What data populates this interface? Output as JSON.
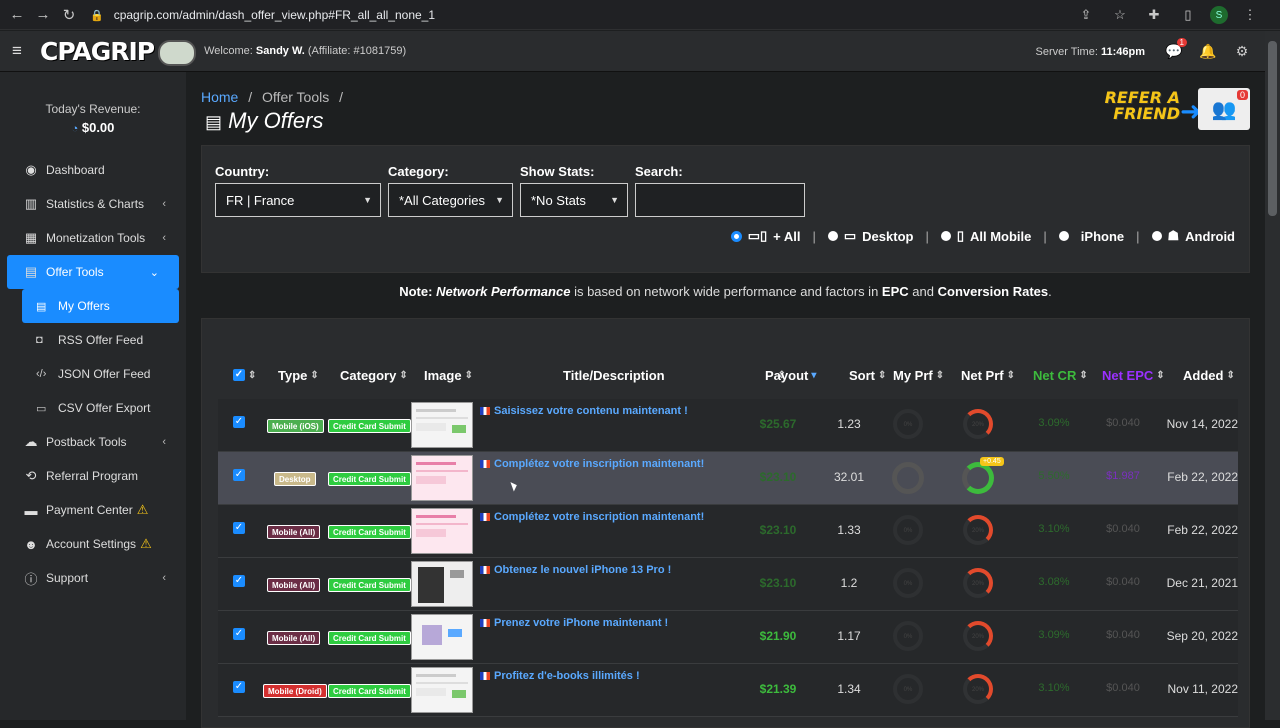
{
  "browser": {
    "url": "cpagrip.com/admin/dash_offer_view.php#FR_all_all_none_1",
    "profile_initial": "S"
  },
  "topbar": {
    "logo": "CPAGRIP",
    "welcome_prefix": "Welcome:",
    "user": "Sandy W.",
    "affiliate": "(Affiliate: #1081759)",
    "server_time_label": "Server Time:",
    "server_time": "11:46pm",
    "messages_count": "1"
  },
  "sidebar": {
    "revenue_label": "Today's Revenue:",
    "revenue_value": "$0.00",
    "items": [
      {
        "label": "Dashboard"
      },
      {
        "label": "Statistics & Charts"
      },
      {
        "label": "Monetization Tools"
      },
      {
        "label": "Offer Tools"
      },
      {
        "label": "My Offers"
      },
      {
        "label": "RSS Offer Feed"
      },
      {
        "label": "JSON Offer Feed"
      },
      {
        "label": "CSV Offer Export"
      },
      {
        "label": "Postback Tools"
      },
      {
        "label": "Referral Program"
      },
      {
        "label": "Payment Center"
      },
      {
        "label": "Account Settings"
      },
      {
        "label": "Support"
      }
    ]
  },
  "breadcrumb": {
    "home": "Home",
    "sep": "/",
    "current": "Offer Tools"
  },
  "page_title": "My Offers",
  "refer": {
    "line1": "REFER A",
    "line2": "FRIEND",
    "count": "0"
  },
  "filters": {
    "country_label": "Country:",
    "country_value": "FR | France",
    "category_label": "Category:",
    "category_value": "*All Categories",
    "stats_label": "Show Stats:",
    "stats_value": "*No Stats",
    "search_label": "Search:",
    "search_value": "",
    "devices": [
      "+ All",
      "Desktop",
      "All Mobile",
      "iPhone",
      "Android"
    ]
  },
  "note": {
    "prefix": "Note:",
    "em": "Network Performance",
    "mid": "is based on network wide performance and factors in",
    "epc": "EPC",
    "and": "and",
    "cr": "Conversion Rates",
    "end": "."
  },
  "table": {
    "headers": [
      "Type",
      "Category",
      "Image",
      "Title/Description",
      "Payout",
      "Sort",
      "My Prf",
      "Net Prf",
      "Net CR",
      "Net EPC",
      "Added"
    ],
    "rows": [
      {
        "type": "Mobile (iOS)",
        "category": "Credit Card Submit",
        "title": "Saisissez votre contenu maintenant !",
        "payout": "$25.67",
        "sort": "1.23",
        "my_prf": "0%",
        "net_prf": "20%",
        "net_cr": "3.09%",
        "net_epc": "$0.040",
        "added": "Nov 14, 2022"
      },
      {
        "type": "Desktop",
        "category": "Credit Card Submit",
        "title": "Complétez votre inscription maintenant!",
        "payout": "$23.10",
        "sort": "32.01",
        "my_prf": "",
        "net_prf": "",
        "net_prf_badge": "+0.45",
        "net_cr": "5.50%",
        "net_epc": "$1.987",
        "added": "Feb 22, 2022"
      },
      {
        "type": "Mobile (All)",
        "category": "Credit Card Submit",
        "title": "Complétez votre inscription maintenant!",
        "payout": "$23.10",
        "sort": "1.33",
        "my_prf": "0%",
        "net_prf": "20%",
        "net_cr": "3.10%",
        "net_epc": "$0.040",
        "added": "Feb 22, 2022"
      },
      {
        "type": "Mobile (All)",
        "category": "Credit Card Submit",
        "title": "Obtenez le nouvel iPhone 13 Pro !",
        "payout": "$23.10",
        "sort": "1.2",
        "my_prf": "0%",
        "net_prf": "20%",
        "net_cr": "3.08%",
        "net_epc": "$0.040",
        "added": "Dec 21, 2021"
      },
      {
        "type": "Mobile (All)",
        "category": "Credit Card Submit",
        "title": "Prenez votre iPhone maintenant !",
        "payout": "$21.90",
        "sort": "1.17",
        "my_prf": "0%",
        "net_prf": "20%",
        "net_cr": "3.09%",
        "net_epc": "$0.040",
        "added": "Sep 20, 2022"
      },
      {
        "type": "Mobile (Droid)",
        "category": "Credit Card Submit",
        "title": "Profitez d'e-books illimités !",
        "payout": "$21.39",
        "sort": "1.34",
        "my_prf": "0%",
        "net_prf": "20%",
        "net_cr": "3.10%",
        "net_epc": "$0.040",
        "added": "Nov 11, 2022"
      }
    ]
  },
  "colors": {
    "accent": "#1a8cff",
    "payout_green": "#3dbb3d",
    "tag_ios": "#4caf50",
    "tag_desktop": "#c9b98a",
    "tag_all": "#6b2d45",
    "tag_droid": "#d32f2f",
    "tag_cat": "#2ecc40"
  }
}
